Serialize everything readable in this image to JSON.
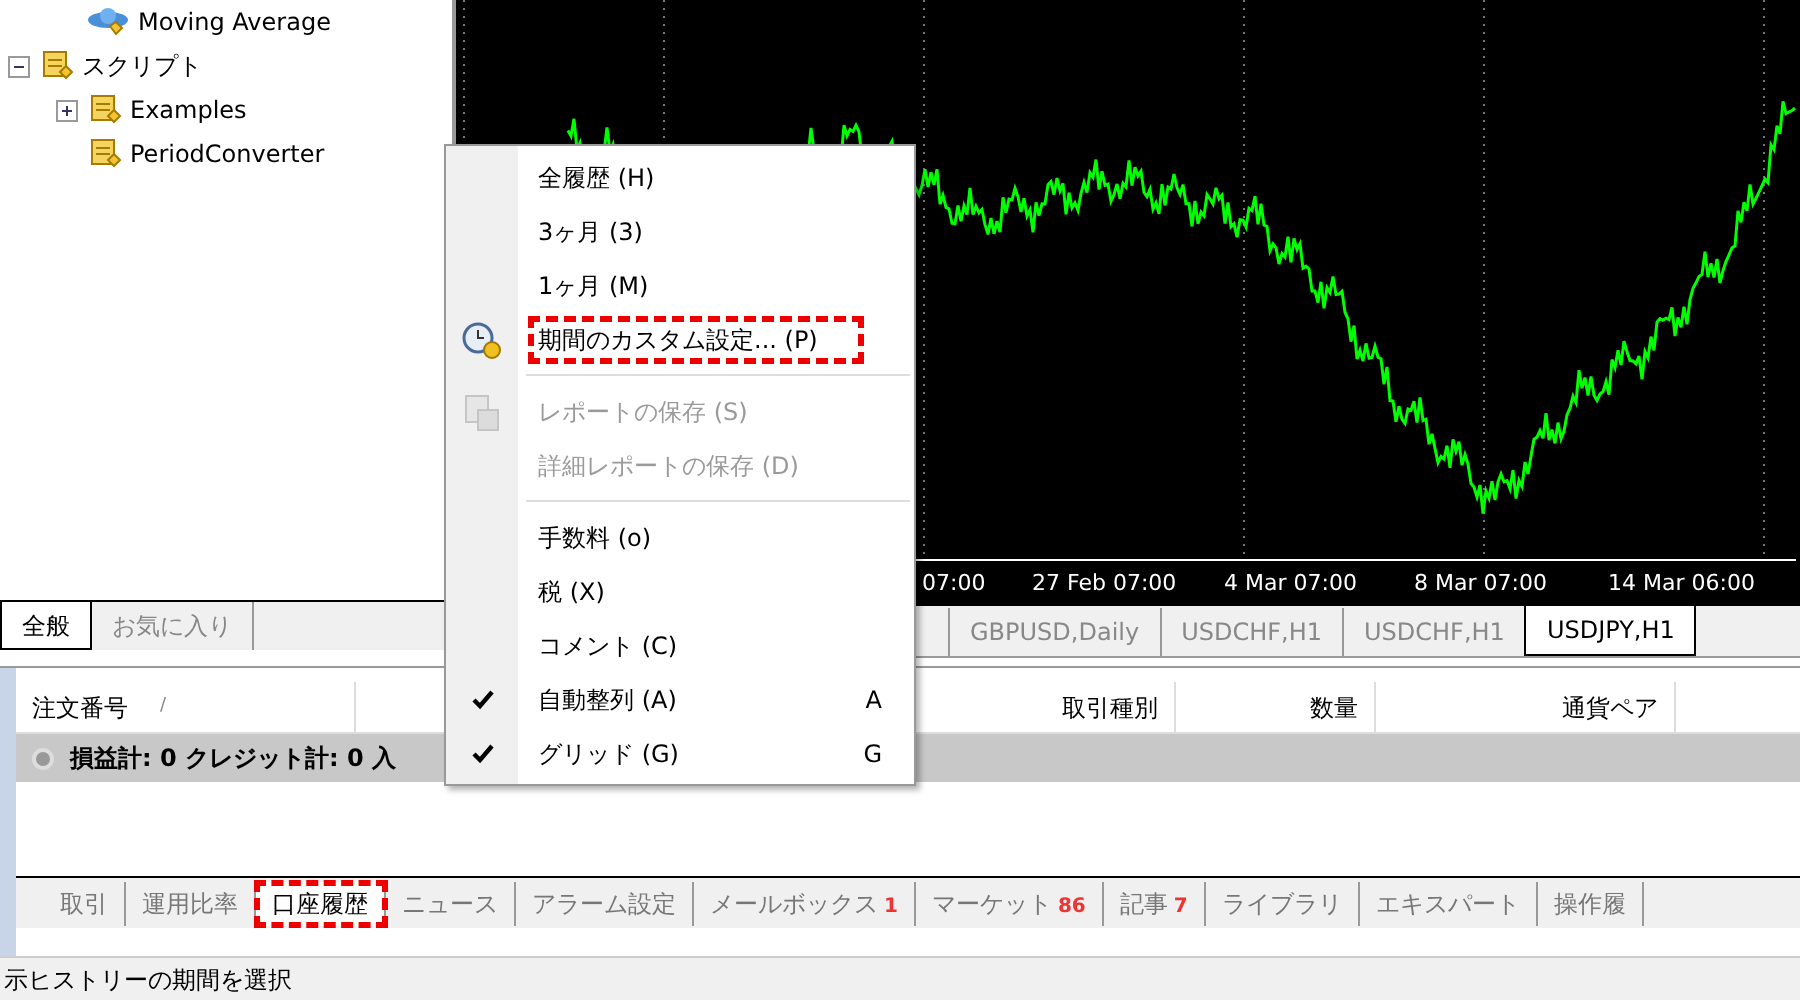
{
  "navigator": {
    "tree": [
      {
        "children": [
          {
            "label": "Moving Average",
            "kind": "indicator"
          }
        ]
      },
      {
        "label": "スクリプト",
        "kind": "script",
        "expanded": true,
        "children": [
          {
            "label": "Examples",
            "kind": "script",
            "expanded": false
          },
          {
            "label": "PeriodConverter",
            "kind": "script"
          }
        ]
      }
    ],
    "tabs": [
      {
        "label": "全般",
        "selected": true
      },
      {
        "label": "お気に入り",
        "selected": false
      }
    ]
  },
  "chart": {
    "time_labels": [
      "07:00",
      "27 Feb 07:00",
      "4 Mar 07:00",
      "8 Mar 07:00",
      "14 Mar 06:00"
    ],
    "tabs": [
      {
        "label": "GBPUSD,Daily",
        "selected": false
      },
      {
        "label": "USDCHF,H1",
        "selected": false
      },
      {
        "label": "USDCHF,H1",
        "selected": false
      },
      {
        "label": "USDJPY,H1",
        "selected": true
      }
    ]
  },
  "terminal": {
    "columns": [
      {
        "label": "注文番号",
        "sort": "/"
      },
      {
        "label": "取引種別"
      },
      {
        "label": "数量"
      },
      {
        "label": "通貨ペア"
      }
    ],
    "summary": "損益計: 0 クレジット計: 0 入",
    "tabs": [
      {
        "label": "取引",
        "selected": false,
        "highlighted": false
      },
      {
        "label": "運用比率",
        "selected": false,
        "highlighted": false
      },
      {
        "label": "口座履歴",
        "selected": true,
        "highlighted": true
      },
      {
        "label": "ニュース",
        "selected": false,
        "highlighted": false
      },
      {
        "label": "アラーム設定",
        "selected": false,
        "highlighted": false
      },
      {
        "label": "メールボックス",
        "count": "1",
        "selected": false,
        "highlighted": false
      },
      {
        "label": "マーケット",
        "count": "86",
        "selected": false,
        "highlighted": false
      },
      {
        "label": "記事",
        "count": "7",
        "selected": false,
        "highlighted": false
      },
      {
        "label": "ライブラリ",
        "selected": false,
        "highlighted": false
      },
      {
        "label": "エキスパート",
        "selected": false,
        "highlighted": false
      },
      {
        "label": "操作履",
        "selected": false,
        "highlighted": false
      }
    ]
  },
  "context_menu": [
    {
      "kind": "item",
      "label": "全履歴 (H)",
      "disabled": false,
      "checked": false,
      "highlighted": false
    },
    {
      "kind": "item",
      "label": "3ヶ月 (3)",
      "disabled": false,
      "checked": false,
      "highlighted": false
    },
    {
      "kind": "item",
      "label": "1ヶ月 (M)",
      "disabled": false,
      "checked": false,
      "highlighted": false
    },
    {
      "kind": "period",
      "label": "期間のカスタム設定... (P)",
      "disabled": false,
      "checked": false,
      "highlighted": true
    },
    {
      "kind": "separator"
    },
    {
      "kind": "report",
      "label": "レポートの保存 (S)",
      "disabled": true,
      "checked": false,
      "highlighted": false
    },
    {
      "kind": "item",
      "label": "詳細レポートの保存 (D)",
      "disabled": true,
      "checked": false,
      "highlighted": false
    },
    {
      "kind": "separator"
    },
    {
      "kind": "item",
      "label": "手数料 (o)",
      "disabled": false,
      "checked": false,
      "highlighted": false
    },
    {
      "kind": "item",
      "label": "税 (X)",
      "disabled": false,
      "checked": false,
      "highlighted": false
    },
    {
      "kind": "item",
      "label": "コメント (C)",
      "disabled": false,
      "checked": false,
      "highlighted": false
    },
    {
      "kind": "item",
      "label": "自動整列 (A)",
      "shortcut": "A",
      "disabled": false,
      "checked": true,
      "highlighted": false
    },
    {
      "kind": "item",
      "label": "グリッド (G)",
      "shortcut": "G",
      "disabled": false,
      "checked": true,
      "highlighted": false
    }
  ],
  "status_bar": {
    "text": "示ヒストリーの期間を選択"
  }
}
